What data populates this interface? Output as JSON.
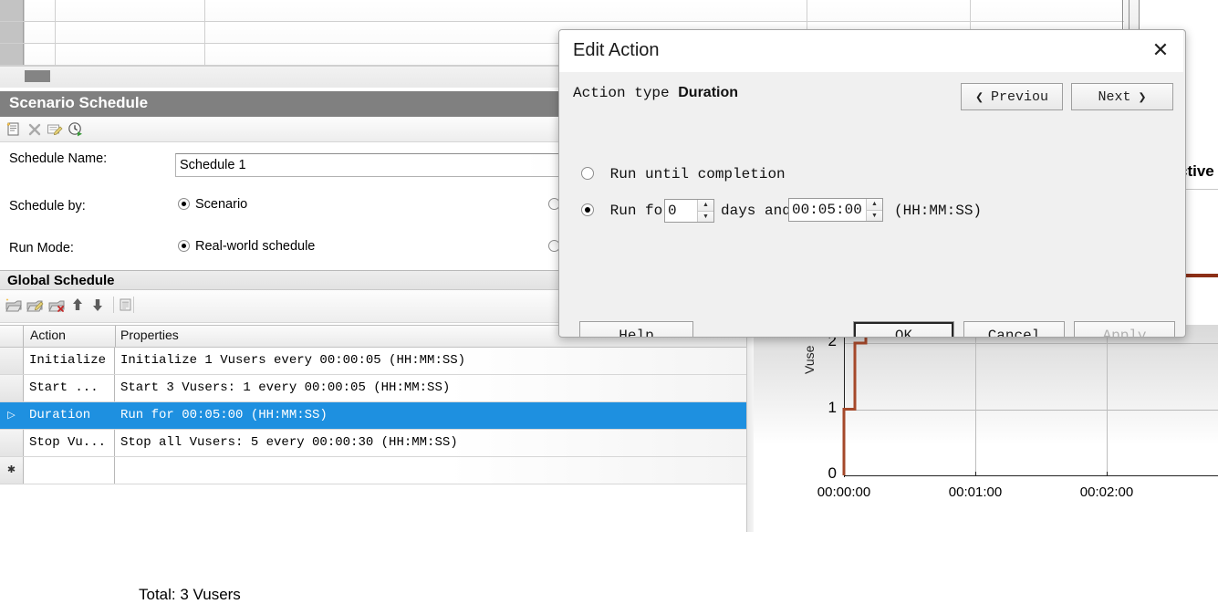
{
  "app": {
    "scenario_panel": {
      "title": "Scenario Schedule",
      "toolbar_icons": [
        "new-schedule-icon",
        "delete-schedule-icon",
        "edit-schedule-icon",
        "run-schedule-icon"
      ],
      "fields": {
        "schedule_name_label": "Schedule Name:",
        "schedule_name_value": "Schedule 1",
        "schedule_by_label": "Schedule by:",
        "schedule_by_selected": "Scenario",
        "run_mode_label": "Run Mode:",
        "run_mode_selected": "Real-world schedule"
      }
    },
    "global_schedule": {
      "title": "Global Schedule",
      "toolbar_icons": [
        "add-action-icon",
        "edit-action-icon",
        "delete-action-icon",
        "move-up-icon",
        "move-down-icon",
        "copy-icon"
      ],
      "total_label": "Total: 3 Vusers",
      "columns": [
        "Action",
        "Properties"
      ],
      "rows": [
        {
          "marker": "",
          "action": "Initialize",
          "properties": "Initialize 1 Vusers every 00:00:05 (HH:MM:SS)",
          "selected": false
        },
        {
          "marker": "",
          "action": "Start ...",
          "properties": "Start 3 Vusers: 1 every 00:00:05 (HH:MM:SS)",
          "selected": false
        },
        {
          "marker": "▷",
          "action": "Duration",
          "properties": "Run for 00:05:00 (HH:MM:SS)",
          "selected": true
        },
        {
          "marker": "",
          "action": "Stop Vu...",
          "properties": "Stop all Vusers: 5 every 00:00:30 (HH:MM:SS)",
          "selected": false
        },
        {
          "marker": "✱",
          "action": "",
          "properties": "",
          "selected": false
        }
      ]
    },
    "chart_legend_text": "ctive",
    "chart_legend_color": "#8c2f17"
  },
  "chart_data": {
    "type": "line",
    "title": "",
    "xlabel": "",
    "ylabel": "Vuse",
    "series": [
      {
        "name": "Active Vusers",
        "color": "#a5482a",
        "step": true,
        "points": [
          {
            "x": "00:00:00",
            "y": 0
          },
          {
            "x": "00:00:00",
            "y": 1
          },
          {
            "x": "00:00:05",
            "y": 1
          },
          {
            "x": "00:00:05",
            "y": 2
          },
          {
            "x": "00:00:10",
            "y": 2
          },
          {
            "x": "00:00:10",
            "y": 3
          }
        ]
      }
    ],
    "yticks": [
      0,
      1,
      2
    ],
    "ylim": [
      0,
      2.3
    ],
    "xticks": [
      "00:00:00",
      "00:01:00",
      "00:02:00"
    ],
    "grid": true,
    "legend_position": "top-right"
  },
  "dialog": {
    "title": "Edit Action",
    "close_icon": "close-icon",
    "action_type_label": "Action type",
    "action_type_value": "Duration",
    "previous_label": "Previou",
    "next_label": "Next",
    "prev_icon": "chevron-left-icon",
    "next_icon": "chevron-right-icon",
    "option_until_completion": "Run until completion",
    "option_until_completion_selected": false,
    "option_run_for": "Run for",
    "option_run_for_selected": true,
    "days_value": "0",
    "days_label": "days and",
    "time_value": "00:05:00",
    "time_format_hint": "(HH:MM:SS)",
    "buttons": {
      "help": "Help",
      "ok": "OK",
      "cancel": "Cancel",
      "apply": "Apply",
      "apply_disabled": true,
      "ok_focused": true
    }
  }
}
